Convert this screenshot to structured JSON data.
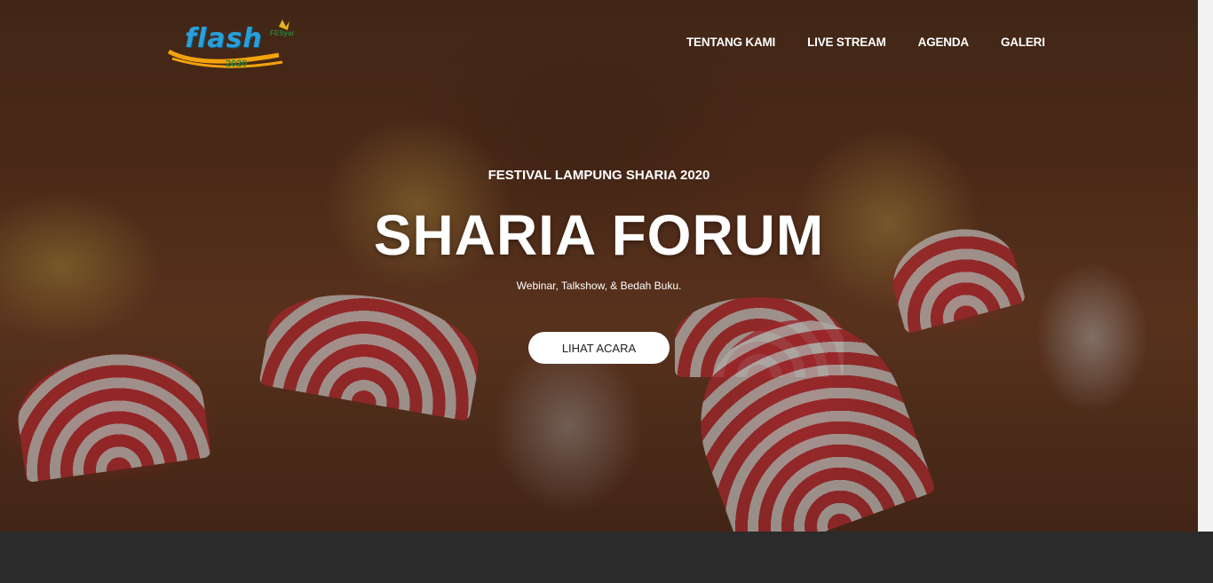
{
  "brand": {
    "logo_text": "flash",
    "logo_year": "2020",
    "logo_sub": "FESyar",
    "colors": {
      "logo_blue": "#2a9fd8",
      "logo_green": "#2e8b3a",
      "logo_orange": "#f2a20c"
    }
  },
  "nav": {
    "items": [
      {
        "label": "TENTANG KAMI"
      },
      {
        "label": "LIVE STREAM"
      },
      {
        "label": "AGENDA"
      },
      {
        "label": "GALERI"
      }
    ]
  },
  "hero": {
    "kicker": "FESTIVAL LAMPUNG SHARIA 2020",
    "title": "SHARIA FORUM",
    "tagline": "Webinar, Talkshow, & Bedah Buku.",
    "cta_label": "LIHAT ACARA",
    "background_icon": "dancers-photo"
  }
}
